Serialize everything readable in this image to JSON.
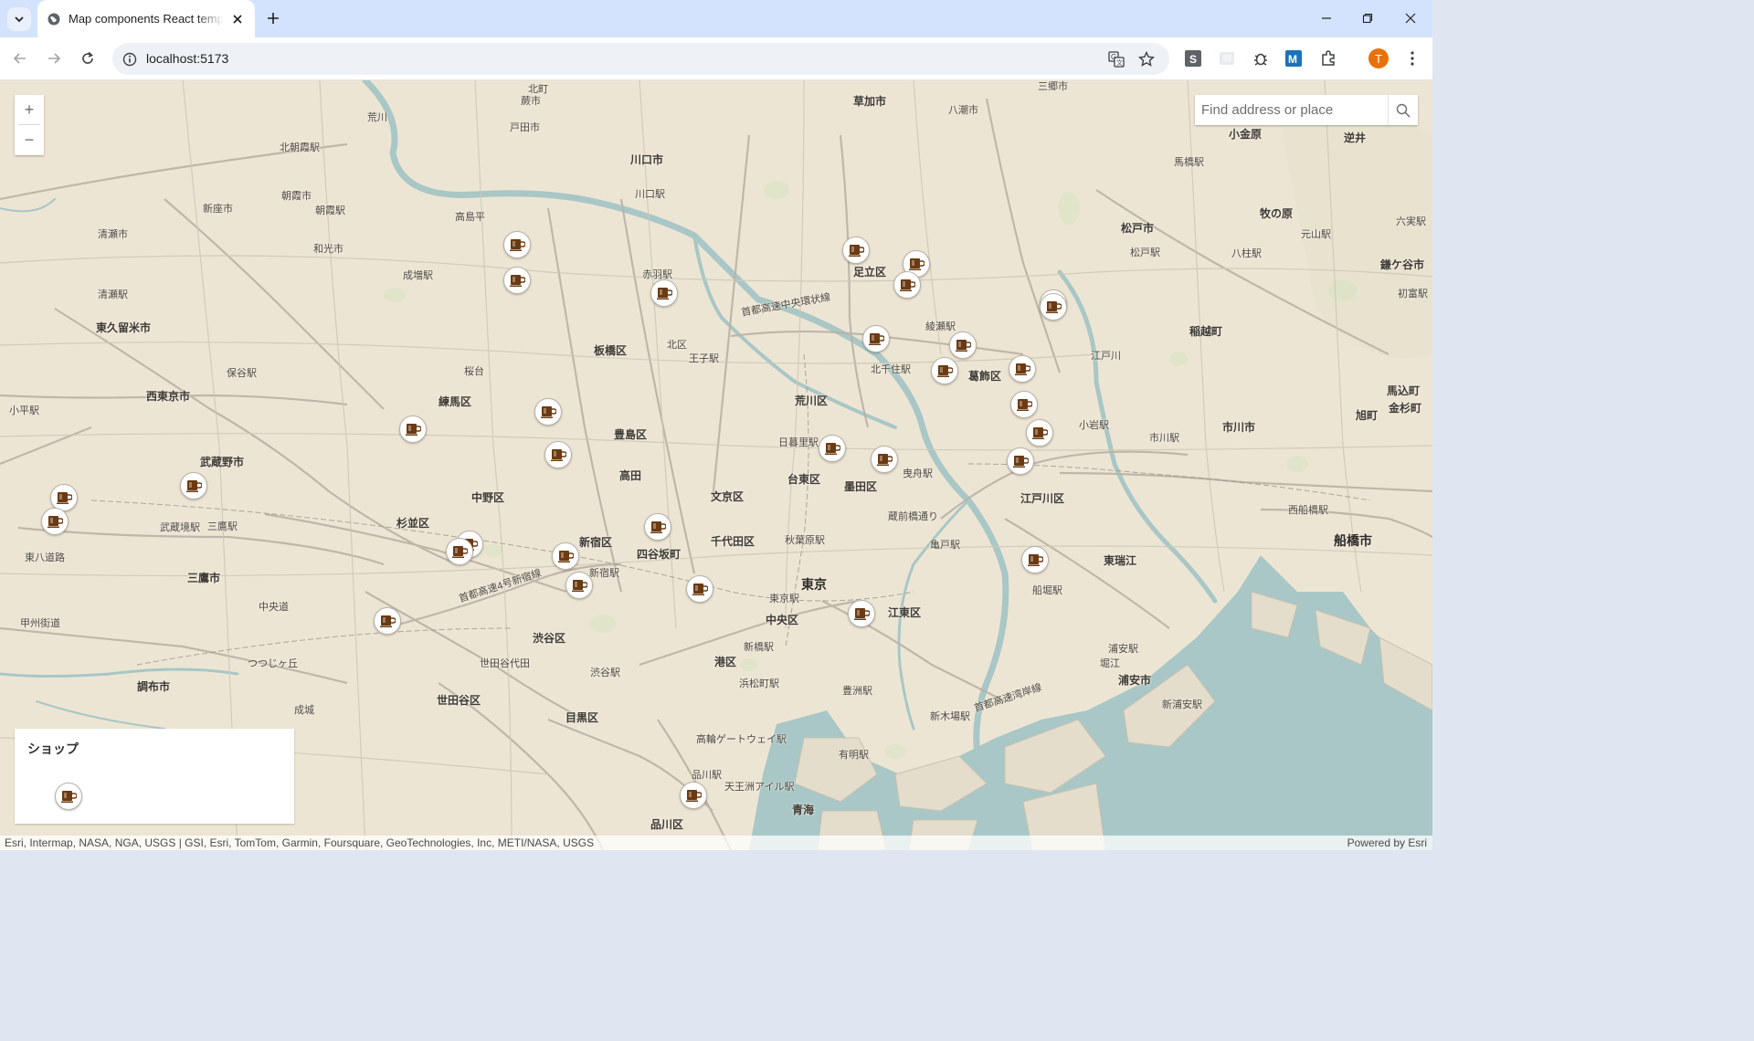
{
  "browser": {
    "tab_title": "Map components React template",
    "url": "localhost:5173",
    "profile_initial": "T",
    "colors": {
      "tabstrip": "#d3e3fd",
      "profile": "#e8710a"
    }
  },
  "map": {
    "search_placeholder": "Find address or place",
    "zoom_in_label": "+",
    "zoom_out_label": "−",
    "legend_title": "ショップ",
    "attribution_left": "Esri, Intermap, NASA, NGA, USGS | GSI, Esri, TomTom, Garmin, Foursquare, GeoTechnologies, Inc, METI/NASA, USGS",
    "attribution_right": "Powered by Esri",
    "marker_icon": "coffee-cup-icon",
    "marker_color": "#6b3a12",
    "places": [
      "草加市",
      "八潮市",
      "三郷市",
      "北町",
      "蕨市",
      "戸田市",
      "川口市",
      "川口駅",
      "北朝霞駅",
      "朝霞市",
      "朝霞駅",
      "新座市",
      "清瀬市",
      "和光市",
      "成増駅",
      "高島平",
      "赤羽駅",
      "板橋区",
      "北区",
      "王子駅",
      "桜台",
      "練馬区",
      "豊島区",
      "荒川区",
      "日暮里駅",
      "足立区",
      "綾瀬駅",
      "北千住駅",
      "葛飾区",
      "江戸川区",
      "墨田区",
      "台東区",
      "文京区",
      "千代田区",
      "秋葉原駅",
      "東京",
      "東京駅",
      "中央区",
      "新橋駅",
      "港区",
      "浜松町駅",
      "渋谷区",
      "渋谷駅",
      "新宿区",
      "新宿駅",
      "四谷坂町",
      "高田",
      "中野区",
      "杉並区",
      "武蔵野市",
      "西東京市",
      "東久留米市",
      "清瀬駅",
      "小平駅",
      "武蔵境駅",
      "三鷹駅",
      "三鷹市",
      "中央道",
      "調布市",
      "つつじヶ丘",
      "成城",
      "世田谷区",
      "世田谷代田",
      "目黒区",
      "品川駅",
      "品川区",
      "高輪ゲートウェイ駅",
      "天王洲アイル駅",
      "青海",
      "有明駅",
      "豊洲駅",
      "新木場駅",
      "江東区",
      "亀戸駅",
      "船堀駅",
      "東瑞江",
      "浦安駅",
      "堀江",
      "浦安市",
      "新浦安駅",
      "市川市",
      "市川駅",
      "小岩駅",
      "船橋市",
      "西船橋駅",
      "稲越町",
      "松戸市",
      "松戸駅",
      "牧の原",
      "八柱駅",
      "元山駅",
      "鎌ケ谷市",
      "小金原",
      "逆井",
      "馬橋駅",
      "旭町",
      "馬込町",
      "金杉町",
      "初富駅",
      "六実駅",
      "荒川",
      "江戸川",
      "曳舟駅",
      "蔵前橋通り",
      "清瀬市",
      "新座市",
      "保谷駅",
      "西東京市",
      "東八道路",
      "甲州街道",
      "首都高速4号新宿線",
      "首都高速中央環状線",
      "首都高速湾岸線"
    ]
  }
}
